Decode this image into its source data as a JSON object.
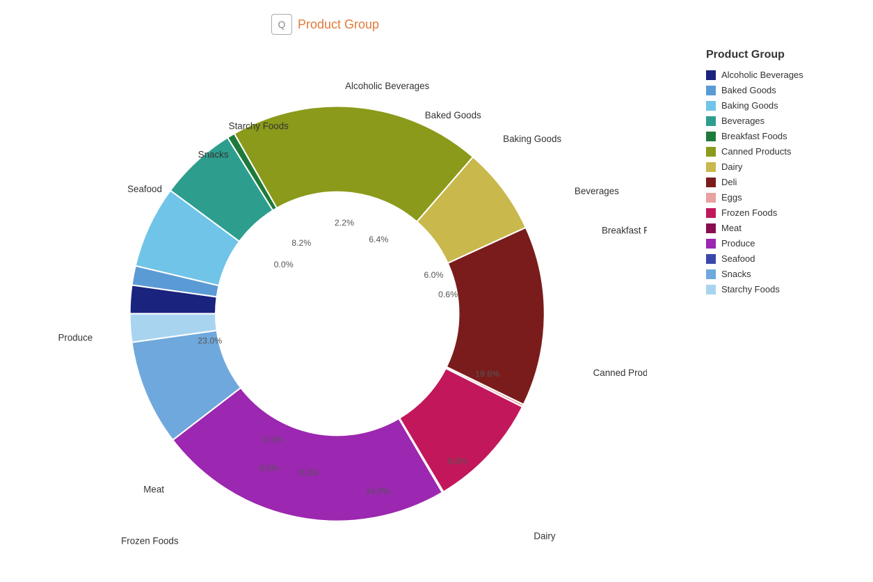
{
  "title": "Product Group",
  "title_icon": "Q",
  "legend_title": "Product Group",
  "segments": [
    {
      "label": "Alcoholic Beverages",
      "percent": 2.2,
      "color": "#1a237e",
      "startAngle": -90,
      "sweepAngle": 7.92
    },
    {
      "label": "Baked Goods",
      "percent": 1.5,
      "color": "#5b9bd5",
      "startAngle": -82.08,
      "sweepAngle": 5.4
    },
    {
      "label": "Baking Goods",
      "percent": 6.4,
      "color": "#70c4e8",
      "startAngle": -76.68,
      "sweepAngle": 23.04
    },
    {
      "label": "Beverages",
      "percent": 6.0,
      "color": "#2d9e8e",
      "startAngle": -53.64,
      "sweepAngle": 21.6
    },
    {
      "label": "Breakfast Foods",
      "percent": 0.6,
      "color": "#1e7a3a",
      "startAngle": -32.04,
      "sweepAngle": 2.16
    },
    {
      "label": "Canned Products",
      "percent": 19.6,
      "color": "#8b9a1a",
      "startAngle": -29.88,
      "sweepAngle": 70.56
    },
    {
      "label": "Dairy",
      "percent": 6.8,
      "color": "#c9b84c",
      "startAngle": 40.68,
      "sweepAngle": 24.48
    },
    {
      "label": "Deli",
      "percent": 14.0,
      "color": "#7a1c1c",
      "startAngle": 65.16,
      "sweepAngle": 50.4
    },
    {
      "label": "Eggs",
      "percent": 0.2,
      "color": "#e8a0a0",
      "startAngle": 115.56,
      "sweepAngle": 0.72
    },
    {
      "label": "Frozen Foods",
      "percent": 9.0,
      "color": "#c2185b",
      "startAngle": 116.28,
      "sweepAngle": 32.4
    },
    {
      "label": "Meat",
      "percent": 0.1,
      "color": "#880e4f",
      "startAngle": 148.68,
      "sweepAngle": 0.36
    },
    {
      "label": "Produce",
      "percent": 23.0,
      "color": "#9c27b0",
      "startAngle": 149.04,
      "sweepAngle": 82.8
    },
    {
      "label": "Seafood",
      "percent": 0.0,
      "color": "#3949ab",
      "startAngle": 231.84,
      "sweepAngle": 0.0
    },
    {
      "label": "Snacks",
      "percent": 8.2,
      "color": "#6fa8dc",
      "startAngle": 231.84,
      "sweepAngle": 29.52
    },
    {
      "label": "Starchy Foods",
      "percent": 2.2,
      "color": "#a8d4f0",
      "startAngle": 261.36,
      "sweepAngle": 7.92
    }
  ],
  "labels": {
    "alcoholic_beverages": "Alcoholic Beverages",
    "baked_goods": "Baked Goods",
    "baking_goods": "Baking Goods",
    "beverages": "Beverages",
    "breakfast_foods": "Breakfast Foods",
    "canned_products": "Canned Products",
    "dairy": "Dairy",
    "deli": "Deli",
    "eggs": "Eggs",
    "frozen_foods": "Frozen Foods",
    "meat": "Meat",
    "produce": "Produce",
    "seafood": "Seafood",
    "snacks": "Snacks",
    "starchy_foods": "Starchy Foods"
  }
}
